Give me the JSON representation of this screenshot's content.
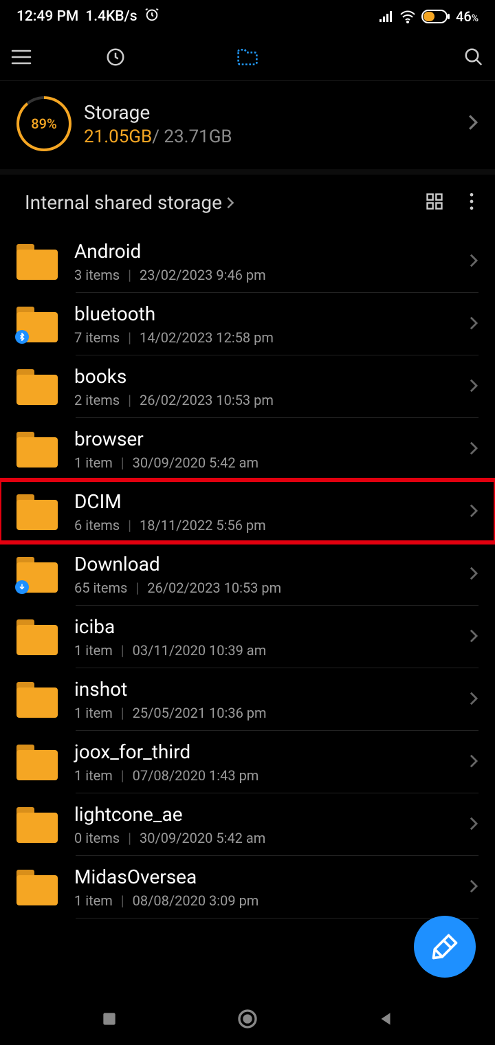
{
  "status": {
    "time": "12:49 PM",
    "speed": "1.4KB/s",
    "battery_pct": "46",
    "battery_suffix": "%"
  },
  "storage": {
    "title": "Storage",
    "pct_label": "89%",
    "pct_css": "89%",
    "used": "21.05GB",
    "sep": "/ ",
    "total": "23.71GB"
  },
  "breadcrumb": {
    "label": "Internal shared storage"
  },
  "folders": [
    {
      "name": "Android",
      "count": "3 items",
      "date": "23/02/2023 9:46 pm",
      "badge": null,
      "highlight": false
    },
    {
      "name": "bluetooth",
      "count": "7 items",
      "date": "14/02/2023 12:58 pm",
      "badge": "bt",
      "highlight": false
    },
    {
      "name": "books",
      "count": "2 items",
      "date": "26/02/2023 10:53 pm",
      "badge": null,
      "highlight": false
    },
    {
      "name": "browser",
      "count": "1 item",
      "date": "30/09/2020 5:42 am",
      "badge": null,
      "highlight": false
    },
    {
      "name": "DCIM",
      "count": "6 items",
      "date": "18/11/2022 5:56 pm",
      "badge": null,
      "highlight": true
    },
    {
      "name": "Download",
      "count": "65 items",
      "date": "26/02/2023 10:53 pm",
      "badge": "dl",
      "highlight": false
    },
    {
      "name": "iciba",
      "count": "1 item",
      "date": "03/11/2020 10:39 am",
      "badge": null,
      "highlight": false
    },
    {
      "name": "inshot",
      "count": "1 item",
      "date": "25/05/2021 10:36 pm",
      "badge": null,
      "highlight": false
    },
    {
      "name": "joox_for_third",
      "count": "1 item",
      "date": "07/08/2020 1:43 pm",
      "badge": null,
      "highlight": false
    },
    {
      "name": "lightcone_ae",
      "count": "0 items",
      "date": "30/09/2020 5:42 am",
      "badge": null,
      "highlight": false
    },
    {
      "name": "MidasOversea",
      "count": "1 item",
      "date": "08/08/2020 3:09 pm",
      "badge": null,
      "highlight": false
    }
  ]
}
